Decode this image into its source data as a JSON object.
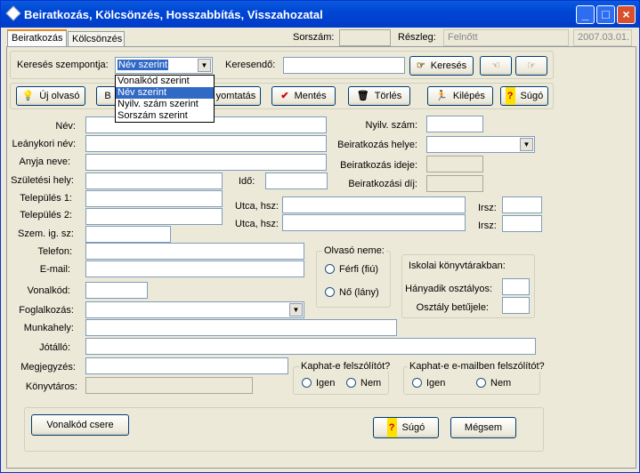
{
  "window": {
    "title": "Beiratkozás, Kölcsönzés, Hosszabbítás, Visszahozatal"
  },
  "tabs": [
    {
      "label": "Beiratkozás"
    },
    {
      "label": "Kölcsönzés"
    }
  ],
  "header": {
    "sorszam_label": "Sorszám:",
    "sorszam_value": "",
    "reszleg_label": "Részleg:",
    "reszleg_value": "Felnőtt",
    "date_value": "2007.03.01."
  },
  "search": {
    "criteria_label": "Keresés szempontja:",
    "criteria_value": "Név szerint",
    "term_label": "Keresendő:",
    "term_value": "",
    "search_button": "Keresés",
    "options": [
      "Vonalkód szerint",
      "Név szerint",
      "Nyilv. szám szerint",
      "Sorszám szerint"
    ],
    "selected_index": 1
  },
  "toolbar": {
    "new_reader": "Új olvasó",
    "b_partial": "B",
    "print_partial": "yomtatás",
    "save": "Mentés",
    "delete": "Törlés",
    "exit": "Kilépés",
    "help": "Súgó"
  },
  "form": {
    "nev": "Név:",
    "leanykori_nev": "Leánykori név:",
    "anyja_neve": "Anyja neve:",
    "szuletesi_hely": "Születési hely:",
    "ido": "Idő:",
    "telepules1": "Település 1:",
    "telepules2": "Település 2:",
    "utca1": "Utca, hsz:",
    "utca2": "Utca, hsz:",
    "hrsz1": "Irsz:",
    "hrsz2": "Irsz:",
    "szem_ig_sz": "Szem. ig. sz:",
    "telefon": "Telefon:",
    "email": "E-mail:",
    "vonalkod": "Vonalkód:",
    "foglalkozas": "Foglalkozás:",
    "munkahely": "Munkahely:",
    "jotallo": "Jótálló:",
    "megjegyzes": "Megjegyzés:",
    "konyvtaros": "Könyvtáros:",
    "nyilv_szam": "Nyilv. szám:",
    "beiratkozas_helye": "Beiratkozás helye:",
    "beiratkozas_ideje": "Beiratkozás ideje:",
    "beiratkozasi_dij": "Beiratkozási díj:"
  },
  "gender": {
    "title": "Olvasó neme:",
    "male": "Férfi (fiú)",
    "female": "Nő (lány)"
  },
  "school": {
    "title": "Iskolai könyvtárakban:",
    "grade": "Hányadik osztályos:",
    "class_mark": "Osztály betűjele:"
  },
  "reminder": {
    "title": "Kaphat-e felszólítót?",
    "yes": "Igen",
    "no": "Nem"
  },
  "email_reminder": {
    "title": "Kaphat-e e-mailben felszólítót?",
    "yes": "Igen",
    "no": "Nem"
  },
  "footer": {
    "barcode_change": "Vonalkód csere",
    "help": "Súgó",
    "cancel": "Mégsem"
  }
}
